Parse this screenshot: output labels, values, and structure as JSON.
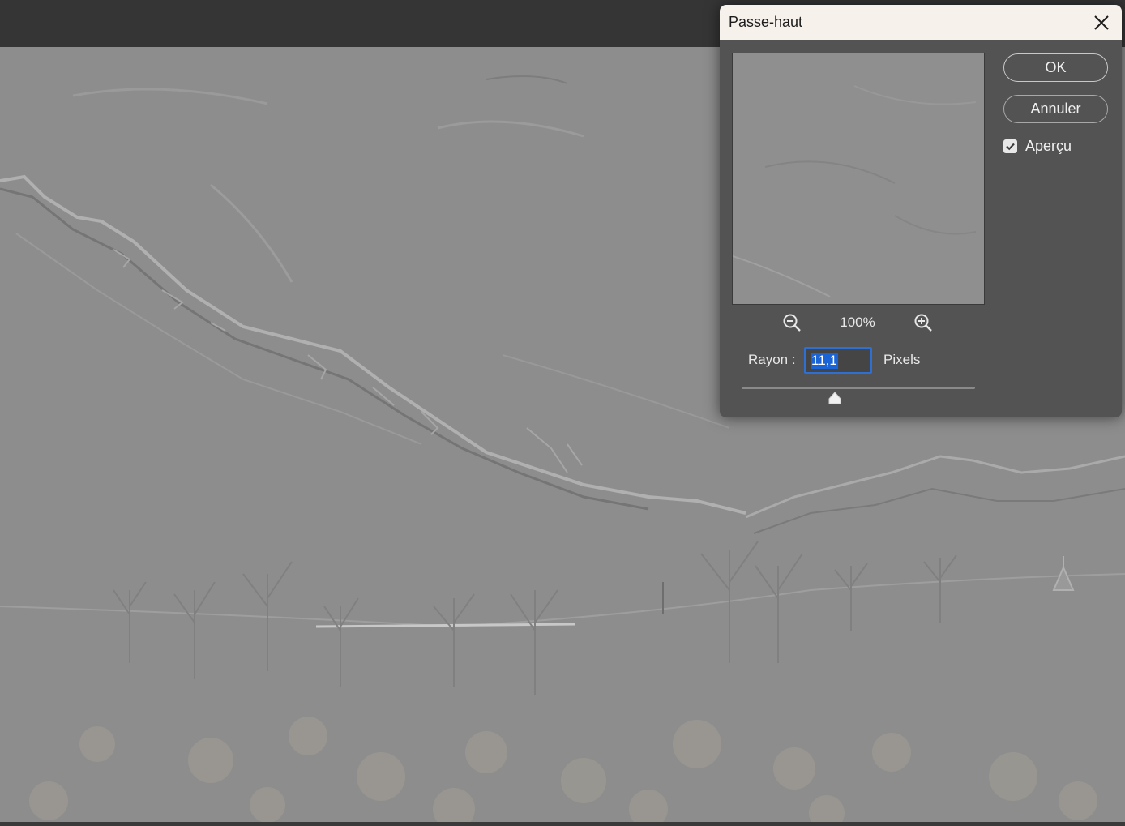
{
  "dialog": {
    "title": "Passe-haut",
    "ok_label": "OK",
    "cancel_label": "Annuler",
    "preview_checkbox_label": "Aperçu",
    "preview_checked": true,
    "zoom_level": "100%",
    "radius_label": "Rayon :",
    "radius_value": "11,1",
    "radius_unit": "Pixels",
    "slider_level_fraction": 0.4
  },
  "icons": {
    "close": "close-icon",
    "zoom_out": "zoom-out-icon",
    "zoom_in": "zoom-in-icon",
    "check": "check-icon",
    "slider_thumb": "slider-thumb-icon"
  }
}
